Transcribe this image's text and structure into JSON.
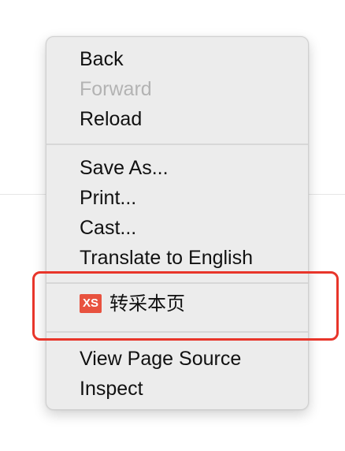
{
  "menu": {
    "back": "Back",
    "forward": "Forward",
    "reload": "Reload",
    "save_as": "Save As...",
    "print": "Print...",
    "cast": "Cast...",
    "translate": "Translate to English",
    "xs_badge": "XS",
    "xs_label": "转采本页",
    "view_source": "View Page Source",
    "inspect": "Inspect"
  },
  "colors": {
    "highlight_border": "#e8352a",
    "badge_bg": "#e8523f",
    "disabled_text": "#b3b3b3"
  },
  "icons": {
    "xs_extension": "xs-extension-icon"
  }
}
